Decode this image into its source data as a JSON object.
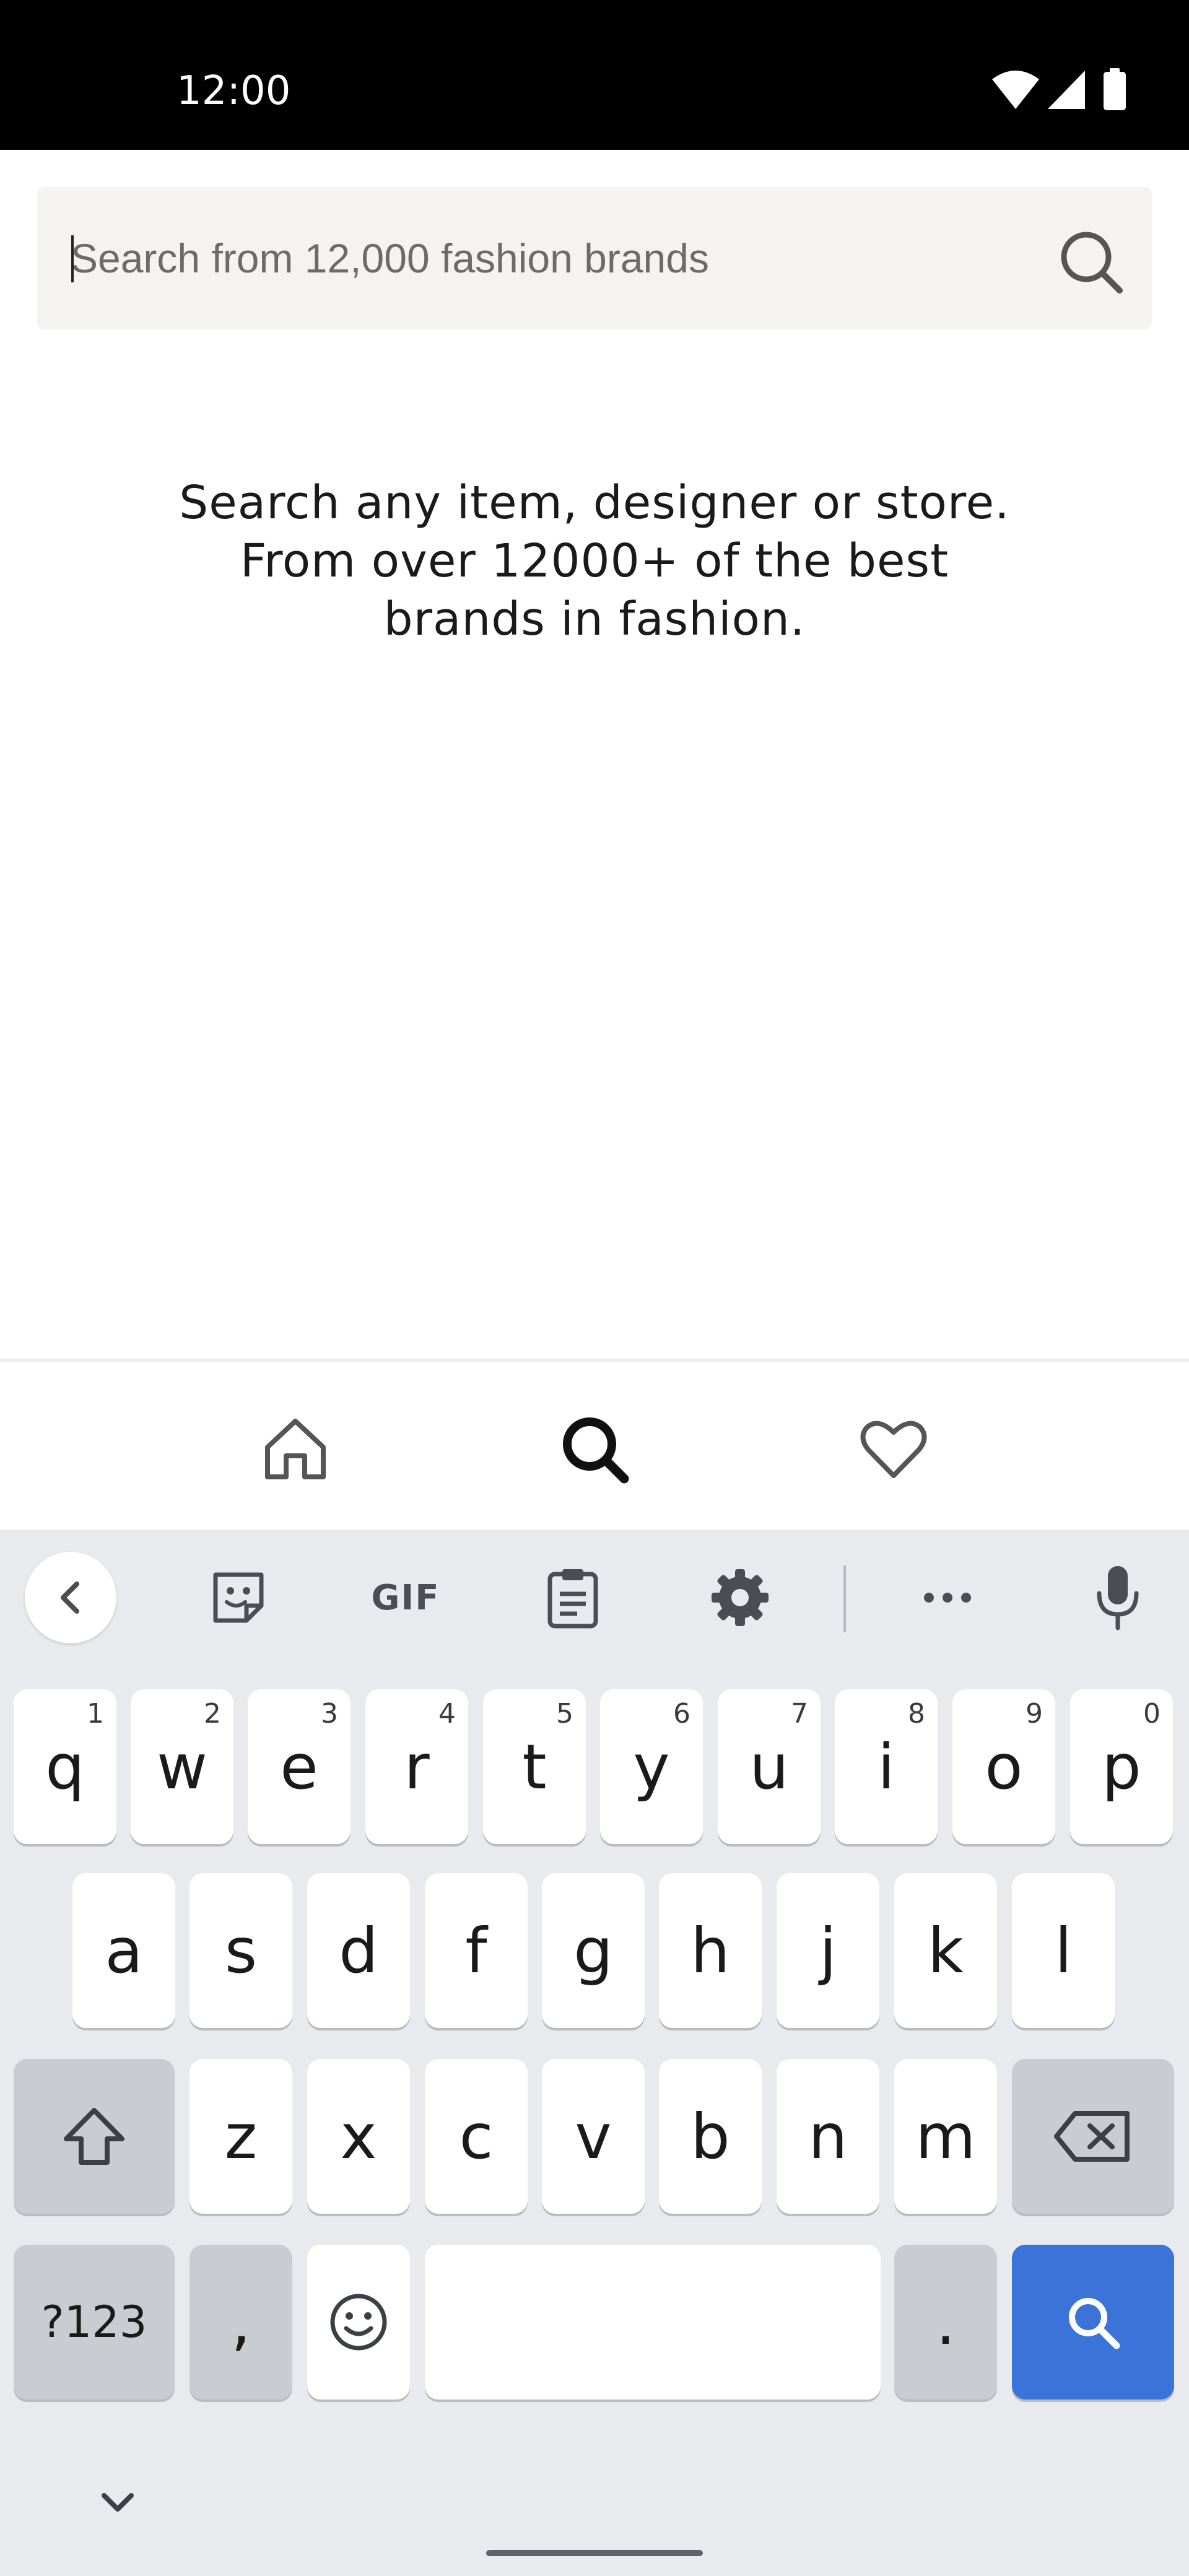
{
  "status_bar": {
    "time": "12:00",
    "icons": [
      "wifi-icon",
      "cellular-signal-icon",
      "battery-icon"
    ]
  },
  "search": {
    "placeholder": "Search from 12,000 fashion brands",
    "value": "",
    "icon": "search-icon"
  },
  "hint": {
    "lines": [
      "Search any item, designer or store.",
      "From over 12000+ of the best",
      "brands in fashion."
    ]
  },
  "bottom_nav": {
    "items": [
      {
        "name": "home",
        "icon": "home-icon",
        "active": false
      },
      {
        "name": "search",
        "icon": "search-icon",
        "active": true
      },
      {
        "name": "favorites",
        "icon": "heart-icon",
        "active": false
      }
    ]
  },
  "keyboard": {
    "toolbar": {
      "items": [
        "back-arrow-icon",
        "sticker-icon",
        "gif",
        "clipboard-icon",
        "settings-icon",
        "more-icon",
        "microphone-icon"
      ],
      "gif_label": "GIF"
    },
    "row1": [
      {
        "key": "q",
        "hint": "1"
      },
      {
        "key": "w",
        "hint": "2"
      },
      {
        "key": "e",
        "hint": "3"
      },
      {
        "key": "r",
        "hint": "4"
      },
      {
        "key": "t",
        "hint": "5"
      },
      {
        "key": "y",
        "hint": "6"
      },
      {
        "key": "u",
        "hint": "7"
      },
      {
        "key": "i",
        "hint": "8"
      },
      {
        "key": "o",
        "hint": "9"
      },
      {
        "key": "p",
        "hint": "0"
      }
    ],
    "row2": [
      "a",
      "s",
      "d",
      "f",
      "g",
      "h",
      "j",
      "k",
      "l"
    ],
    "row3": [
      "z",
      "x",
      "c",
      "v",
      "b",
      "n",
      "m"
    ],
    "row4": {
      "symbols_label": "?123",
      "comma_label": ",",
      "period_label": ".",
      "space_label": "",
      "action_icon": "search-icon"
    },
    "accent_color": "#3b73d8"
  }
}
